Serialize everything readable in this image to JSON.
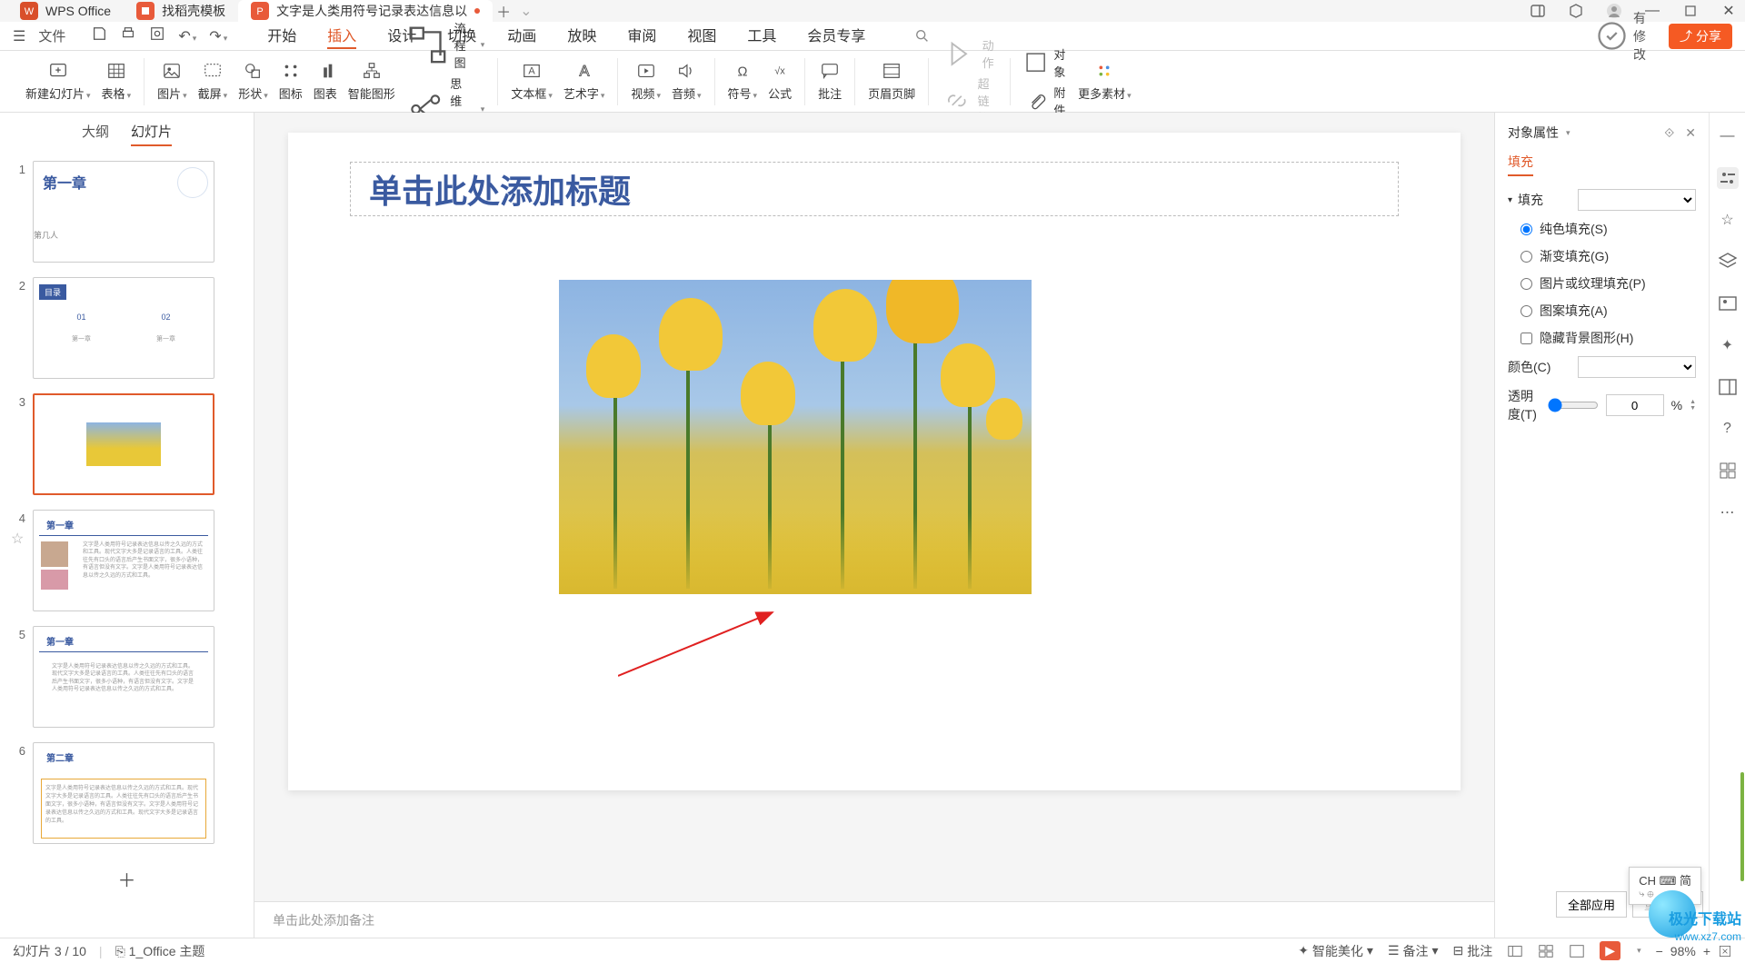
{
  "titlebar": {
    "tabs": [
      {
        "label": "WPS Office",
        "icon": "wps-logo"
      },
      {
        "label": "找稻壳模板",
        "icon": "template-icon"
      },
      {
        "label": "文字是人类用符号记录表达信息以",
        "icon": "ppt-icon",
        "active": true,
        "dirty": true
      }
    ]
  },
  "menubar": {
    "file_label": "文件",
    "tabs": [
      "开始",
      "插入",
      "设计",
      "切换",
      "动画",
      "放映",
      "审阅",
      "视图",
      "工具",
      "会员专享"
    ],
    "active_tab": "插入",
    "has_changes": "有修改",
    "share_label": "分享"
  },
  "ribbon": {
    "new_slide": "新建幻灯片",
    "table": "表格",
    "image": "图片",
    "screenshot": "截屏",
    "shape": "形状",
    "icon": "图标",
    "chart": "图表",
    "smartart": "智能图形",
    "flowchart": "流程图",
    "mindmap": "思维导图",
    "textbox": "文本框",
    "wordart": "艺术字",
    "video": "视频",
    "audio": "音频",
    "symbol": "符号",
    "formula": "公式",
    "comment": "批注",
    "header_footer": "页眉页脚",
    "action": "动作",
    "hyperlink": "超链接",
    "object": "对象",
    "attachment": "附件",
    "more": "更多素材"
  },
  "slide_panel": {
    "tabs": [
      "大纲",
      "幻灯片"
    ],
    "active": "幻灯片",
    "slides": [
      {
        "num": 1,
        "title": "第一章",
        "sub": "第几人"
      },
      {
        "num": 2,
        "toc_header": "目录",
        "items": [
          "01",
          "02"
        ],
        "subs": [
          "第一章",
          "第一章"
        ]
      },
      {
        "num": 3,
        "selected": true
      },
      {
        "num": 4,
        "title": "第一章"
      },
      {
        "num": 5,
        "title": "第一章"
      },
      {
        "num": 6,
        "title": "第二章"
      }
    ]
  },
  "canvas": {
    "title_placeholder": "单击此处添加标题",
    "notes_placeholder": "单击此处添加备注"
  },
  "right_panel": {
    "header": "对象属性",
    "tab": "填充",
    "section_fill": "填充",
    "fill_solid": "纯色填充(S)",
    "fill_gradient": "渐变填充(G)",
    "fill_picture": "图片或纹理填充(P)",
    "fill_pattern": "图案填充(A)",
    "hide_bg": "隐藏背景图形(H)",
    "color_label": "颜色(C)",
    "opacity_label": "透明度(T)",
    "opacity_value": "0",
    "opacity_unit": "%"
  },
  "panel_footer": {
    "apply_all": "全部应用",
    "reset_bg": "重置背景"
  },
  "ime": {
    "lang": "CH",
    "mode": "简"
  },
  "statusbar": {
    "slide_indicator": "幻灯片 3 / 10",
    "theme": "1_Office 主题",
    "beautify": "智能美化",
    "notes": "备注",
    "comments": "批注",
    "zoom": "98%"
  }
}
